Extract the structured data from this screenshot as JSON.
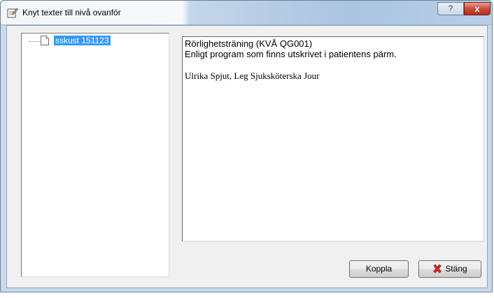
{
  "window": {
    "title": "Knyt texter till nivå ovanför",
    "help_label": "?",
    "close_label": "x"
  },
  "tree": {
    "items": [
      {
        "label": "sskust 151123",
        "icon": "document-icon",
        "selected": true
      }
    ]
  },
  "text": {
    "line1": "Rörlighetsträning (KVÅ QG001)",
    "line2": "Enligt program som finns utskrivet i patientens pärm.",
    "signature": "Ulrika Spjut, Leg Sjuksköterska Jour"
  },
  "buttons": {
    "koppla": "Koppla",
    "stang": "Stäng"
  },
  "colors": {
    "selection": "#3399ff",
    "close_button": "#c9452f",
    "stang_icon": "#d8261d"
  }
}
